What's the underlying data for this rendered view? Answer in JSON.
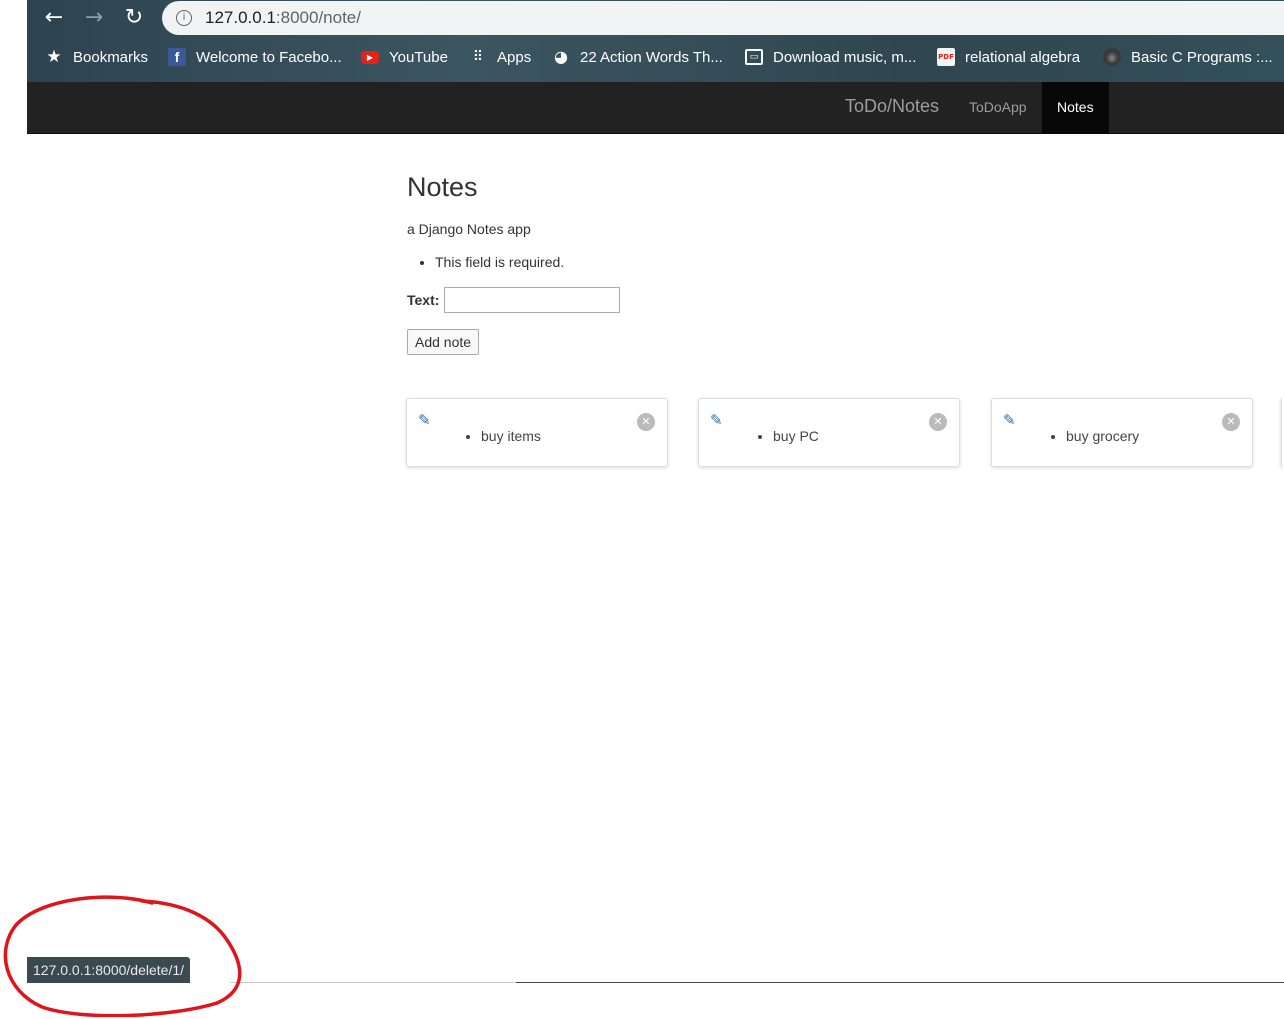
{
  "browser": {
    "url_host": "127.0.0.1",
    "url_rest": ":8000/note/",
    "bookmarks": [
      {
        "label": "Bookmarks",
        "icon": "star-icon"
      },
      {
        "label": "Welcome to Facebo...",
        "icon": "facebook-icon"
      },
      {
        "label": "YouTube",
        "icon": "youtube-icon"
      },
      {
        "label": "Apps",
        "icon": "apps-grid-icon"
      },
      {
        "label": "22 Action Words Th...",
        "icon": "globe-icon"
      },
      {
        "label": "Download music, m...",
        "icon": "download-site-icon"
      },
      {
        "label": "relational algebra",
        "icon": "pdf-icon"
      },
      {
        "label": "Basic C Programs :...",
        "icon": "site-icon"
      }
    ]
  },
  "navbar": {
    "brand": "ToDo/Notes",
    "links": [
      {
        "label": "ToDoApp",
        "active": false
      },
      {
        "label": "Notes",
        "active": true
      }
    ]
  },
  "page": {
    "title": "Notes",
    "subtitle": "a Django Notes app",
    "error": "This field is required.",
    "text_label": "Text:",
    "text_value": "",
    "add_button": "Add note"
  },
  "notes": [
    {
      "text": "buy items"
    },
    {
      "text": "buy PC"
    },
    {
      "text": "buy grocery"
    }
  ],
  "status_bar": "127.0.0.1:8000/delete/1/",
  "colors": {
    "navbar_bg": "#222222",
    "active_nav": "#080808",
    "edit_icon": "#2a6db0",
    "annotation": "#e0141b"
  }
}
